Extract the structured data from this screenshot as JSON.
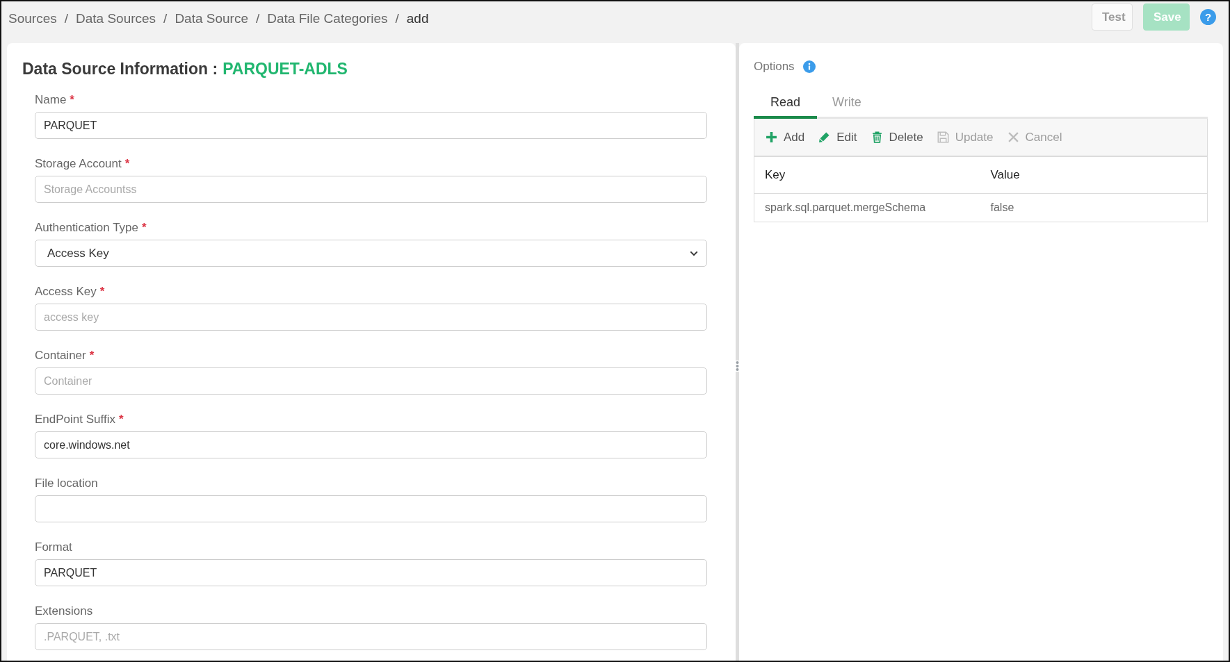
{
  "breadcrumb": [
    {
      "label": "Sources",
      "current": false,
      "separator": "/"
    },
    {
      "label": "Data Sources",
      "current": false,
      "separator": "/"
    },
    {
      "label": "Data Source",
      "current": false,
      "separator": "/"
    },
    {
      "label": "Data File Categories",
      "current": false,
      "separator": "/"
    },
    {
      "label": "add",
      "current": true
    }
  ],
  "header_actions": [
    {
      "kind": "outline",
      "label": "Test",
      "disabled": true
    },
    {
      "kind": "primary",
      "label": "Save",
      "disabled": true
    }
  ],
  "help_button": {
    "label": "?"
  },
  "form": {
    "title": "Data Source Information :",
    "source_name": "PARQUET-ADLS",
    "fields": [
      {
        "kind": "text",
        "label": "Name",
        "required_mark": "*",
        "value": "PARQUET"
      },
      {
        "kind": "text",
        "label": "Storage Account",
        "required_mark": "*",
        "placeholder": "Storage Accountss"
      },
      {
        "kind": "select",
        "label": "Authentication Type",
        "required_mark": "*",
        "value": "Access Key"
      },
      {
        "kind": "text",
        "label": "Access Key",
        "required_mark": "*",
        "placeholder": "access key"
      },
      {
        "kind": "text",
        "label": "Container",
        "required_mark": "*",
        "placeholder": "Container"
      },
      {
        "kind": "text",
        "label": "EndPoint Suffix",
        "required_mark": "*",
        "value": "core.windows.net"
      },
      {
        "kind": "text",
        "label": "File location"
      },
      {
        "kind": "text",
        "label": "Format",
        "value": "PARQUET"
      },
      {
        "kind": "text",
        "label": "Extensions",
        "placeholder": ".PARQUET, .txt"
      }
    ]
  },
  "options": {
    "title": "Options",
    "tabs": [
      {
        "label": "Read",
        "selected": true
      },
      {
        "label": "Write",
        "selected": false
      }
    ],
    "toolbar": [
      {
        "kind": "add",
        "label": "Add",
        "disabled": false
      },
      {
        "kind": "edit",
        "label": "Edit",
        "disabled": false
      },
      {
        "kind": "delete",
        "label": "Delete",
        "disabled": false
      },
      {
        "kind": "update",
        "label": "Update",
        "disabled": true
      },
      {
        "kind": "cancel",
        "label": "Cancel",
        "disabled": true
      }
    ],
    "table": {
      "columns": [
        "Key",
        "Value"
      ],
      "rows": [
        [
          "spark.sql.parquet.mergeSchema",
          "false"
        ]
      ]
    }
  }
}
